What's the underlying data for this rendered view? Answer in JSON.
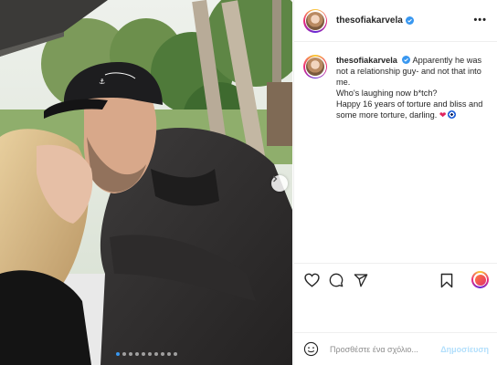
{
  "post": {
    "username": "thesofiakarvela",
    "verified": true,
    "more_icon": "more-horizontal-icon",
    "caption": {
      "username": "thesofiakarvela",
      "lines": [
        "Apparently he was not a relationship guy- and not that into me.",
        "Who's laughing now b*tch?",
        "Happy 16 years of torture and bliss and some more torture, darling."
      ]
    },
    "carousel": {
      "total_slides": 10,
      "active_slide": 1
    }
  },
  "actions": {
    "icons": [
      "heart-icon",
      "comment-icon",
      "share-icon",
      "bookmark-icon"
    ]
  },
  "comment": {
    "placeholder": "Προσθέστε ένα σχόλιο...",
    "post_label": "Δημοσίευση"
  },
  "colors": {
    "accent_blue": "#3897f0",
    "post_button_disabled": "#b2dffc",
    "verified_blue": "#3897f0",
    "heart_red": "#e0245e"
  }
}
